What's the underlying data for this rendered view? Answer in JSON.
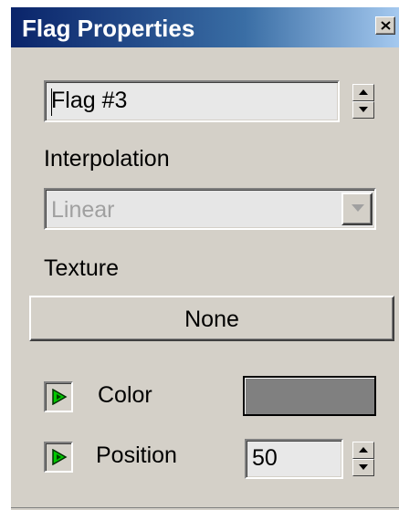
{
  "window": {
    "title": "Flag Properties",
    "close_icon": "close-icon"
  },
  "flag_name": {
    "value": "Flag #3"
  },
  "interpolation": {
    "label": "Interpolation",
    "selected": "Linear",
    "enabled": false
  },
  "texture": {
    "label": "Texture",
    "button_label": "None"
  },
  "color": {
    "label": "Color",
    "swatch_hex": "#808080",
    "animate_icon": "animate-key-icon"
  },
  "position": {
    "label": "Position",
    "value": "50",
    "animate_icon": "animate-key-icon"
  },
  "colors": {
    "panel": "#d4d0c8",
    "titlebar_start": "#0a246a",
    "titlebar_end": "#a6caf0",
    "animate_green": "#00c800"
  }
}
